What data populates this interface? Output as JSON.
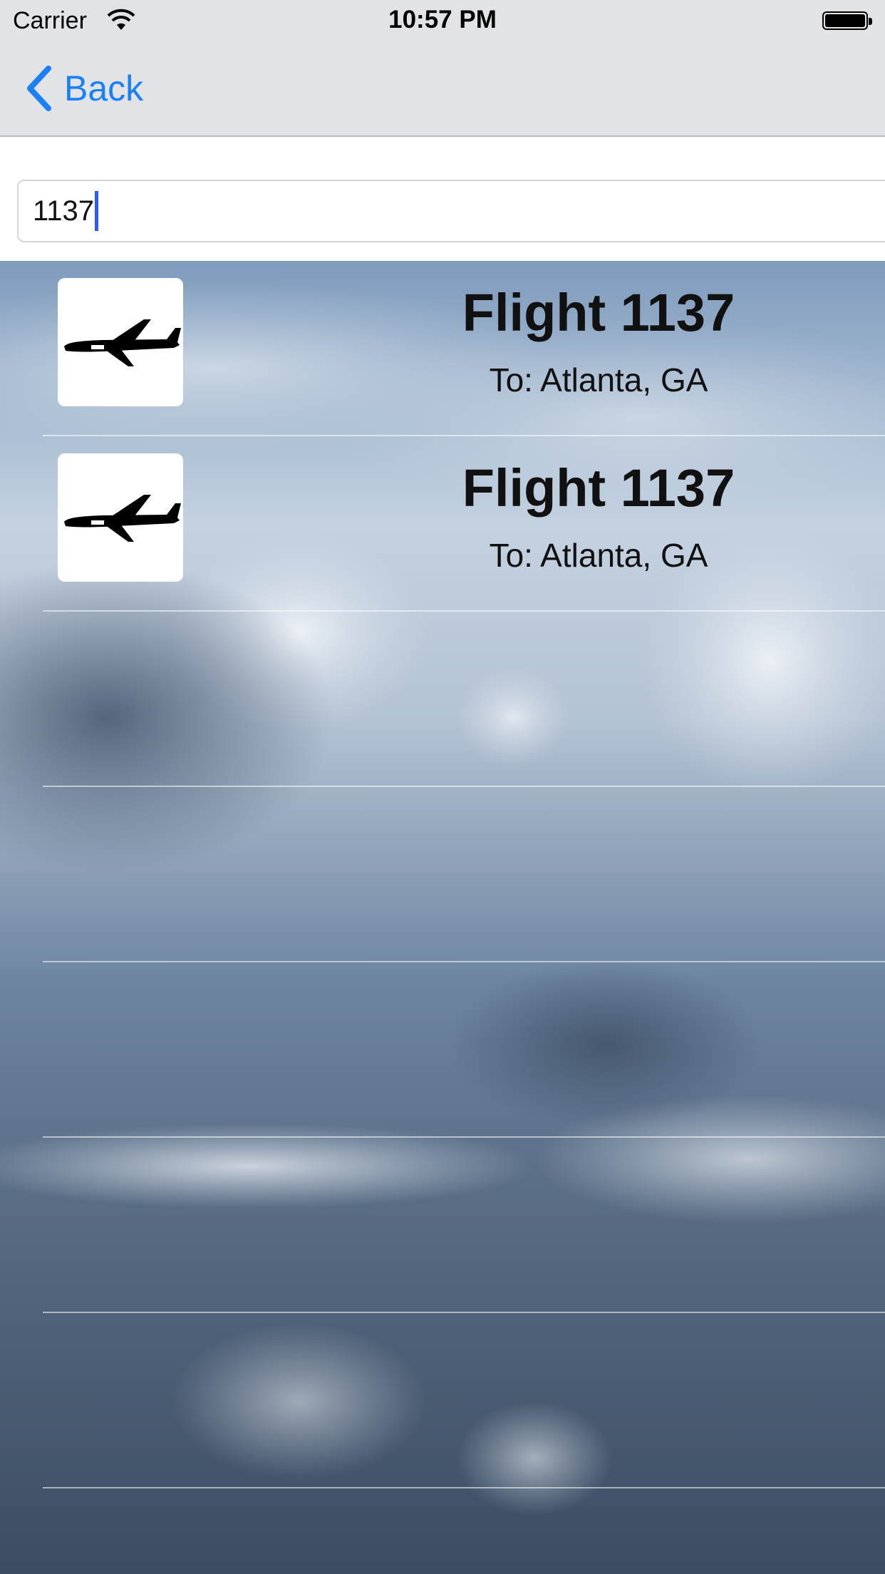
{
  "status_bar": {
    "carrier": "Carrier",
    "time": "10:57 PM"
  },
  "nav": {
    "back_label": "Back"
  },
  "search": {
    "value": "1137"
  },
  "results": [
    {
      "title": "Flight 1137",
      "destination": "To: Atlanta, GA",
      "icon": "airplane-icon"
    },
    {
      "title": "Flight 1137",
      "destination": "To: Atlanta, GA",
      "icon": "airplane-icon"
    }
  ],
  "colors": {
    "accent": "#1a80f3",
    "caret": "#2b5cf6",
    "bar_bg": "#e1e3e6"
  }
}
